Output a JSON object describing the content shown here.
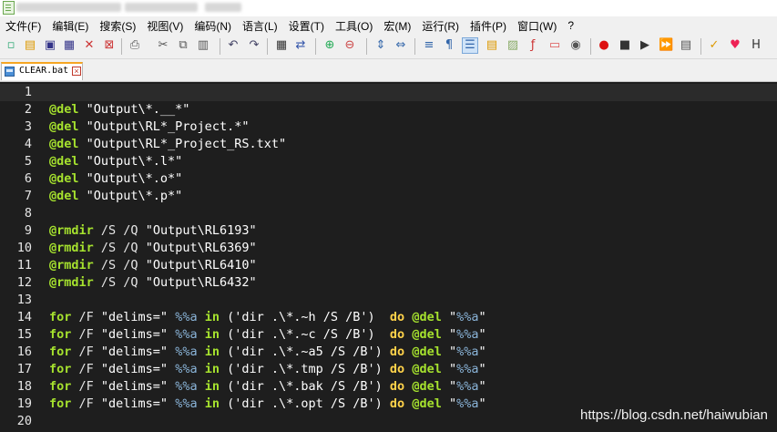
{
  "menu": [
    "文件(F)",
    "编辑(E)",
    "搜索(S)",
    "视图(V)",
    "编码(N)",
    "语言(L)",
    "设置(T)",
    "工具(O)",
    "宏(M)",
    "运行(R)",
    "插件(P)",
    "窗口(W)",
    "?"
  ],
  "tab": {
    "filename": "CLEAR.bat"
  },
  "lines": [
    {
      "num": "1",
      "tokens": []
    },
    {
      "num": "2",
      "tokens": [
        {
          "t": "kw",
          "v": "@del"
        },
        {
          "t": "str",
          "v": " \"Output\\*.__*\""
        }
      ]
    },
    {
      "num": "3",
      "tokens": [
        {
          "t": "kw",
          "v": "@del"
        },
        {
          "t": "str",
          "v": " \"Output\\RL*_Project.*\""
        }
      ]
    },
    {
      "num": "4",
      "tokens": [
        {
          "t": "kw",
          "v": "@del"
        },
        {
          "t": "str",
          "v": " \"Output\\RL*_Project_RS.txt\""
        }
      ]
    },
    {
      "num": "5",
      "tokens": [
        {
          "t": "kw",
          "v": "@del"
        },
        {
          "t": "str",
          "v": " \"Output\\*.l*\""
        }
      ]
    },
    {
      "num": "6",
      "tokens": [
        {
          "t": "kw",
          "v": "@del"
        },
        {
          "t": "str",
          "v": " \"Output\\*.o*\""
        }
      ]
    },
    {
      "num": "7",
      "tokens": [
        {
          "t": "kw",
          "v": "@del"
        },
        {
          "t": "str",
          "v": " \"Output\\*.p*\""
        }
      ]
    },
    {
      "num": "8",
      "tokens": []
    },
    {
      "num": "9",
      "tokens": [
        {
          "t": "kw",
          "v": "@rmdir"
        },
        {
          "t": "flag",
          "v": " /S /Q "
        },
        {
          "t": "str",
          "v": "\"Output\\RL6193\""
        }
      ]
    },
    {
      "num": "10",
      "tokens": [
        {
          "t": "kw",
          "v": "@rmdir"
        },
        {
          "t": "flag",
          "v": " /S /Q "
        },
        {
          "t": "str",
          "v": "\"Output\\RL6369\""
        }
      ]
    },
    {
      "num": "11",
      "tokens": [
        {
          "t": "kw",
          "v": "@rmdir"
        },
        {
          "t": "flag",
          "v": " /S /Q "
        },
        {
          "t": "str",
          "v": "\"Output\\RL6410\""
        }
      ]
    },
    {
      "num": "12",
      "tokens": [
        {
          "t": "kw",
          "v": "@rmdir"
        },
        {
          "t": "flag",
          "v": " /S /Q "
        },
        {
          "t": "str",
          "v": "\"Output\\RL6432\""
        }
      ]
    },
    {
      "num": "13",
      "tokens": []
    },
    {
      "num": "14",
      "tokens": [
        {
          "t": "kw",
          "v": "for"
        },
        {
          "t": "flag",
          "v": " /F "
        },
        {
          "t": "str",
          "v": "\"delims=\" "
        },
        {
          "t": "var",
          "v": "%%a"
        },
        {
          "t": "flag",
          "v": " "
        },
        {
          "t": "kw",
          "v": "in"
        },
        {
          "t": "str",
          "v": " ('dir .\\*.~h /S /B')  "
        },
        {
          "t": "ctl",
          "v": "do"
        },
        {
          "t": "flag",
          "v": " "
        },
        {
          "t": "kw",
          "v": "@del"
        },
        {
          "t": "str",
          "v": " \""
        },
        {
          "t": "var",
          "v": "%%a"
        },
        {
          "t": "str",
          "v": "\""
        }
      ]
    },
    {
      "num": "15",
      "tokens": [
        {
          "t": "kw",
          "v": "for"
        },
        {
          "t": "flag",
          "v": " /F "
        },
        {
          "t": "str",
          "v": "\"delims=\" "
        },
        {
          "t": "var",
          "v": "%%a"
        },
        {
          "t": "flag",
          "v": " "
        },
        {
          "t": "kw",
          "v": "in"
        },
        {
          "t": "str",
          "v": " ('dir .\\*.~c /S /B')  "
        },
        {
          "t": "ctl",
          "v": "do"
        },
        {
          "t": "flag",
          "v": " "
        },
        {
          "t": "kw",
          "v": "@del"
        },
        {
          "t": "str",
          "v": " \""
        },
        {
          "t": "var",
          "v": "%%a"
        },
        {
          "t": "str",
          "v": "\""
        }
      ]
    },
    {
      "num": "16",
      "tokens": [
        {
          "t": "kw",
          "v": "for"
        },
        {
          "t": "flag",
          "v": " /F "
        },
        {
          "t": "str",
          "v": "\"delims=\" "
        },
        {
          "t": "var",
          "v": "%%a"
        },
        {
          "t": "flag",
          "v": " "
        },
        {
          "t": "kw",
          "v": "in"
        },
        {
          "t": "str",
          "v": " ('dir .\\*.~a5 /S /B') "
        },
        {
          "t": "ctl",
          "v": "do"
        },
        {
          "t": "flag",
          "v": " "
        },
        {
          "t": "kw",
          "v": "@del"
        },
        {
          "t": "str",
          "v": " \""
        },
        {
          "t": "var",
          "v": "%%a"
        },
        {
          "t": "str",
          "v": "\""
        }
      ]
    },
    {
      "num": "17",
      "tokens": [
        {
          "t": "kw",
          "v": "for"
        },
        {
          "t": "flag",
          "v": " /F "
        },
        {
          "t": "str",
          "v": "\"delims=\" "
        },
        {
          "t": "var",
          "v": "%%a"
        },
        {
          "t": "flag",
          "v": " "
        },
        {
          "t": "kw",
          "v": "in"
        },
        {
          "t": "str",
          "v": " ('dir .\\*.tmp /S /B') "
        },
        {
          "t": "ctl",
          "v": "do"
        },
        {
          "t": "flag",
          "v": " "
        },
        {
          "t": "kw",
          "v": "@del"
        },
        {
          "t": "str",
          "v": " \""
        },
        {
          "t": "var",
          "v": "%%a"
        },
        {
          "t": "str",
          "v": "\""
        }
      ]
    },
    {
      "num": "18",
      "tokens": [
        {
          "t": "kw",
          "v": "for"
        },
        {
          "t": "flag",
          "v": " /F "
        },
        {
          "t": "str",
          "v": "\"delims=\" "
        },
        {
          "t": "var",
          "v": "%%a"
        },
        {
          "t": "flag",
          "v": " "
        },
        {
          "t": "kw",
          "v": "in"
        },
        {
          "t": "str",
          "v": " ('dir .\\*.bak /S /B') "
        },
        {
          "t": "ctl",
          "v": "do"
        },
        {
          "t": "flag",
          "v": " "
        },
        {
          "t": "kw",
          "v": "@del"
        },
        {
          "t": "str",
          "v": " \""
        },
        {
          "t": "var",
          "v": "%%a"
        },
        {
          "t": "str",
          "v": "\""
        }
      ]
    },
    {
      "num": "19",
      "tokens": [
        {
          "t": "kw",
          "v": "for"
        },
        {
          "t": "flag",
          "v": " /F "
        },
        {
          "t": "str",
          "v": "\"delims=\" "
        },
        {
          "t": "var",
          "v": "%%a"
        },
        {
          "t": "flag",
          "v": " "
        },
        {
          "t": "kw",
          "v": "in"
        },
        {
          "t": "str",
          "v": " ('dir .\\*.opt /S /B') "
        },
        {
          "t": "ctl",
          "v": "do"
        },
        {
          "t": "flag",
          "v": " "
        },
        {
          "t": "kw",
          "v": "@del"
        },
        {
          "t": "str",
          "v": " \""
        },
        {
          "t": "var",
          "v": "%%a"
        },
        {
          "t": "str",
          "v": "\""
        }
      ]
    },
    {
      "num": "20",
      "tokens": []
    }
  ],
  "current_line": "1",
  "watermark": "https://blog.csdn.net/haiwubian",
  "colors": {
    "keyword": "#a6e22e",
    "control": "#ffd24a",
    "variable": "#8ab4d8",
    "background": "#1e1e1e"
  },
  "toolbar_icons": [
    "new-file-icon",
    "open-file-icon",
    "save-icon",
    "save-all-icon",
    "close-icon",
    "close-all-icon",
    "print-icon",
    "cut-icon",
    "copy-icon",
    "paste-icon",
    "undo-icon",
    "redo-icon",
    "find-icon",
    "replace-icon",
    "zoom-in-icon",
    "zoom-out-icon",
    "sync-vertical-icon",
    "sync-horizontal-icon",
    "word-wrap-icon",
    "show-all-chars-icon",
    "indent-guide-icon",
    "folder-workspace-icon",
    "document-map-icon",
    "function-list-icon",
    "folder-icon",
    "monitor-icon",
    "record-macro-icon",
    "stop-macro-icon",
    "play-macro-icon",
    "run-macro-multiple-icon",
    "save-macro-icon",
    "spell-check-icon",
    "heart-icon",
    "h-icon"
  ]
}
